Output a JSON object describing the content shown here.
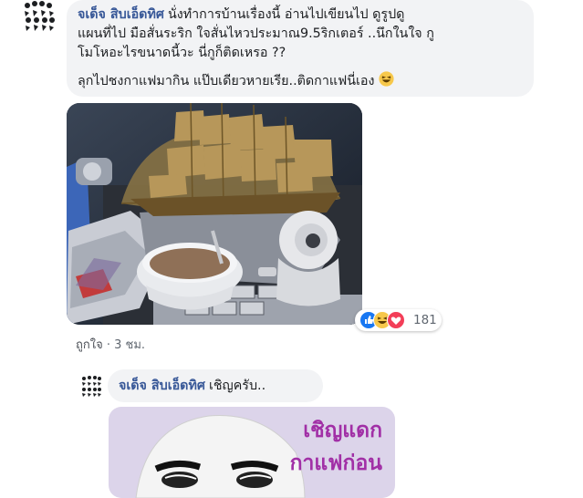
{
  "comment": {
    "author": "จเด็จ สิบเอ็ดทิศ",
    "text_line1": "นั่งทำการบ้านเรื่องนี้ อ่านไปเขียนไป ดูรูปดู",
    "text_line2": "แผนที่ไป มือสั่นระริก ใจสั่นไหวประมาณ9.5ริกเตอร์ ..นึกในใจ กู",
    "text_line3": "โมโหอะไรขนาดนี้วะ นี่กูก็ติดเหรอ ??",
    "text_para2": "ลุกไปชงกาแฟมากิน แป๊บเดียวหายเรีย..ติดกาแฟนี่เอง",
    "emoji_icon": "laughing-emoji-icon",
    "reaction_icons": [
      "like-reaction-icon",
      "haha-reaction-icon",
      "love-reaction-icon"
    ],
    "reaction_count": "181",
    "like_label": "ถูกใจ",
    "separator": "·",
    "time": "3 ชม."
  },
  "reply": {
    "author": "จเด็จ สิบเอ็ดทิศ",
    "text": "เชิญครับ..",
    "sticker_line1": "เชิญแดก",
    "sticker_line2": "กาแฟก่อน"
  },
  "colors": {
    "author_link": "#385898",
    "bubble_bg": "#f2f3f5",
    "like_blue": "#1877f2",
    "haha_yellow": "#f7c84b",
    "love_red": "#f33e58",
    "sticker_text": "#a12fa6"
  }
}
